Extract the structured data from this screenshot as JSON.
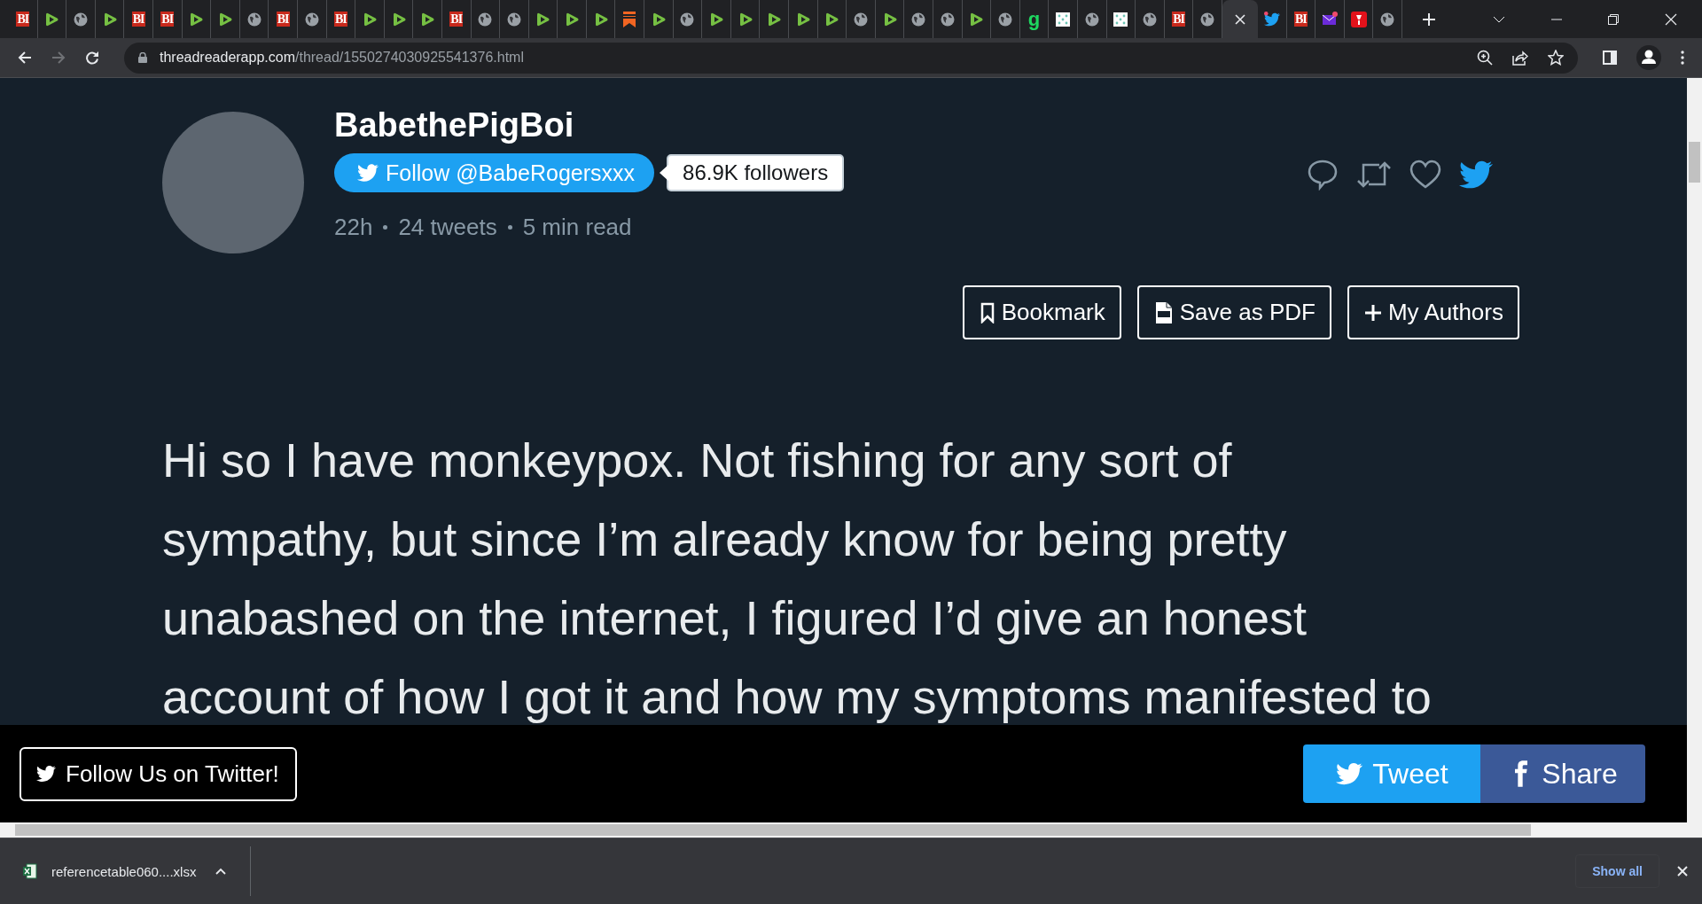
{
  "tabs": [
    {
      "kind": "bi",
      "glyph": "BI",
      "selected": false
    },
    {
      "kind": "play",
      "selected": false
    },
    {
      "kind": "globe",
      "selected": false
    },
    {
      "kind": "play",
      "selected": false
    },
    {
      "kind": "bi",
      "glyph": "BI",
      "selected": false
    },
    {
      "kind": "bi",
      "glyph": "BI",
      "selected": false
    },
    {
      "kind": "play",
      "selected": false
    },
    {
      "kind": "play",
      "selected": false
    },
    {
      "kind": "globe",
      "selected": false
    },
    {
      "kind": "bi",
      "glyph": "BI",
      "selected": false
    },
    {
      "kind": "globe",
      "selected": false
    },
    {
      "kind": "bi",
      "glyph": "BI",
      "selected": false
    },
    {
      "kind": "play",
      "selected": false
    },
    {
      "kind": "play",
      "selected": false
    },
    {
      "kind": "play",
      "selected": false
    },
    {
      "kind": "bi",
      "glyph": "BI",
      "selected": false
    },
    {
      "kind": "globe",
      "selected": false
    },
    {
      "kind": "globe",
      "selected": false
    },
    {
      "kind": "play",
      "selected": false
    },
    {
      "kind": "play",
      "selected": false
    },
    {
      "kind": "play",
      "selected": false
    },
    {
      "kind": "bookmark",
      "selected": false
    },
    {
      "kind": "play",
      "selected": false
    },
    {
      "kind": "globe",
      "selected": false
    },
    {
      "kind": "play",
      "selected": false
    },
    {
      "kind": "play",
      "selected": false
    },
    {
      "kind": "play",
      "selected": false
    },
    {
      "kind": "play",
      "selected": false
    },
    {
      "kind": "play",
      "selected": false
    },
    {
      "kind": "globe",
      "selected": false
    },
    {
      "kind": "play",
      "selected": false
    },
    {
      "kind": "globe",
      "selected": false
    },
    {
      "kind": "globe",
      "selected": false
    },
    {
      "kind": "play",
      "selected": false
    },
    {
      "kind": "globe",
      "selected": false
    },
    {
      "kind": "g",
      "glyph": "g",
      "selected": false
    },
    {
      "kind": "grid",
      "selected": false
    },
    {
      "kind": "globe",
      "selected": false
    },
    {
      "kind": "grid",
      "selected": false
    },
    {
      "kind": "globe",
      "selected": false
    },
    {
      "kind": "bi",
      "glyph": "BI",
      "selected": false
    },
    {
      "kind": "globe",
      "selected": false
    },
    {
      "selected": true
    },
    {
      "kind": "twitter",
      "badge": true,
      "selected": false
    },
    {
      "kind": "bi",
      "glyph": "BI",
      "selected": false
    },
    {
      "kind": "mail",
      "badge": true,
      "selected": false
    },
    {
      "kind": "red",
      "selected": false
    },
    {
      "kind": "globe",
      "selected": false
    }
  ],
  "toolbar": {
    "url_host": "threadreaderapp.com",
    "url_path": "/thread/1550274030925541376.html",
    "forward_disabled": true
  },
  "author": {
    "name": "BabethePigBoi",
    "follow_button": "Follow @BabeRogersxxx",
    "followers": "86.9K followers",
    "meta": [
      "22h",
      "24 tweets",
      "5 min read"
    ]
  },
  "actions": [
    "Bookmark",
    "Save as PDF",
    "My Authors"
  ],
  "thread_text": "Hi so I have monkeypox. Not fishing for any sort of\nsympathy, but since I’m already know for being pretty\nunabashed on the internet, I figured I’d give an honest\naccount of how I got it and how my symptoms manifested to",
  "bottom_bar": {
    "follow": "Follow Us on Twitter!",
    "tweet": "Tweet",
    "share": "Share"
  },
  "download_bar": {
    "file": "referencetable060....xlsx",
    "show_all": "Show all"
  }
}
